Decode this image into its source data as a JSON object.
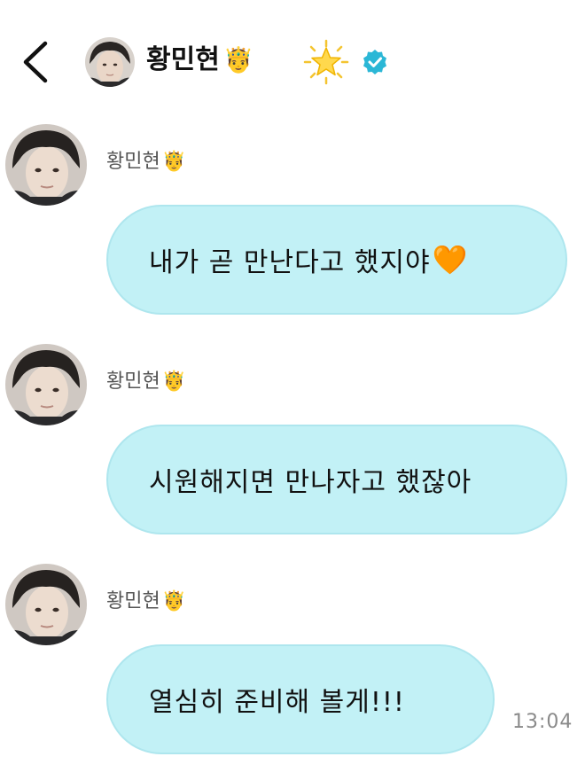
{
  "header": {
    "back_label": "<",
    "name": "황민현",
    "name_emoji": "🤴",
    "star_emoji": "🌟",
    "verified": true
  },
  "messages": [
    {
      "sender": "황민현",
      "sender_emoji": "🤴",
      "text": "내가 곧 만난다고 했지야",
      "text_emoji": "🧡"
    },
    {
      "sender": "황민현",
      "sender_emoji": "🤴",
      "text": "시원해지면 만나자고 했잖아",
      "text_emoji": ""
    },
    {
      "sender": "황민현",
      "sender_emoji": "🤴",
      "text": "열심히 준비해 볼게!!!",
      "text_emoji": ""
    }
  ],
  "timestamp": "13:04",
  "colors": {
    "bubble": "#c2f1f6",
    "verified": "#2bb7d6",
    "timestamp": "#8a8a8a"
  }
}
